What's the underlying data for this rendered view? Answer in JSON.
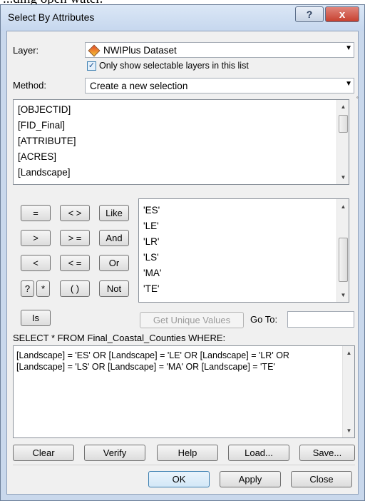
{
  "caption": "...ding open water.",
  "window": {
    "title": "Select By Attributes",
    "help": "?",
    "close": "x"
  },
  "layer": {
    "label": "Layer:",
    "value": "NWIPlus Dataset",
    "checkbox_label": "Only show selectable layers in this list",
    "checked": true
  },
  "method": {
    "label": "Method:",
    "value": "Create a new selection"
  },
  "fields": [
    "[OBJECTID]",
    "[FID_Final]",
    "[ATTRIBUTE]",
    "[ACRES]",
    "[Landscape]"
  ],
  "operators": {
    "eq": "=",
    "ne": "< >",
    "like": "Like",
    "gt": ">",
    "ge": "> =",
    "and": "And",
    "lt": "<",
    "le": "< =",
    "or": "Or",
    "q": "?",
    "star": "*",
    "paren": "( )",
    "not": "Not",
    "is": "Is"
  },
  "values": [
    "'ES'",
    "'LE'",
    "'LR'",
    "'LS'",
    "'MA'",
    "'TE'"
  ],
  "get_unique": "Get Unique Values",
  "goto_label": "Go To:",
  "goto_value": "",
  "select_label": "SELECT * FROM Final_Coastal_Counties WHERE:",
  "where_lines": [
    "[Landscape] = 'ES' OR [Landscape] = 'LE' OR [Landscape] = 'LR' OR",
    "[Landscape] = 'LS' OR [Landscape] = 'MA' OR [Landscape] = 'TE'"
  ],
  "buttons": {
    "clear": "Clear",
    "verify": "Verify",
    "help": "Help",
    "load": "Load...",
    "save": "Save..."
  },
  "footer": {
    "ok": "OK",
    "apply": "Apply",
    "close": "Close"
  }
}
